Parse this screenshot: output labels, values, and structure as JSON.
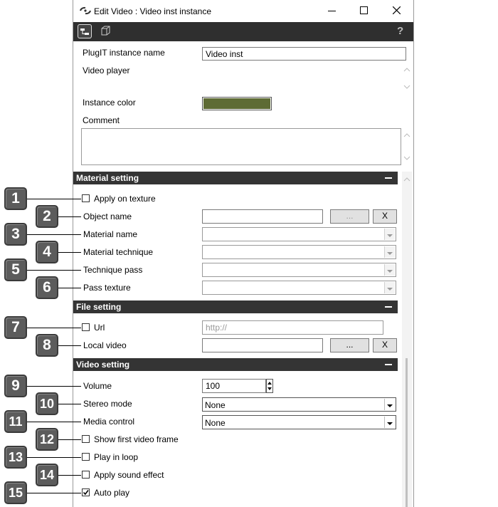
{
  "window": {
    "title": "Edit Video : Video inst instance",
    "minimize_glyph": "—",
    "maximize_glyph": "☐",
    "close_glyph": "✕"
  },
  "toolbar": {
    "help_glyph": "?"
  },
  "header": {
    "instance_name_label": "PlugIT instance name",
    "instance_name_value": "Video inst",
    "player_label": "Video player",
    "color_label": "Instance color",
    "color_value": "#5e6b35",
    "comment_label": "Comment",
    "comment_value": ""
  },
  "material": {
    "title": "Material setting",
    "apply_on_texture": "Apply on texture",
    "apply_on_texture_checked": false,
    "object_name_label": "Object name",
    "object_name_value": "",
    "browse_label": "...",
    "clear_label": "X",
    "material_name_label": "Material name",
    "material_technique_label": "Material technique",
    "technique_pass_label": "Technique pass",
    "pass_texture_label": "Pass texture"
  },
  "file": {
    "title": "File setting",
    "url_label": "Url",
    "url_checked": false,
    "url_placeholder": "http://",
    "local_video_label": "Local video",
    "local_video_value": "",
    "browse_label": "...",
    "clear_label": "X"
  },
  "video": {
    "title": "Video setting",
    "volume_label": "Volume",
    "volume_value": "100",
    "stereo_label": "Stereo mode",
    "stereo_value": "None",
    "media_control_label": "Media control",
    "media_control_value": "None",
    "show_first_frame": "Show first video frame",
    "show_first_frame_checked": false,
    "play_in_loop": "Play in loop",
    "play_in_loop_checked": false,
    "apply_sound_effect": "Apply sound effect",
    "apply_sound_effect_checked": false,
    "auto_play": "Auto play",
    "auto_play_checked": true
  },
  "callouts": [
    "1",
    "2",
    "3",
    "4",
    "5",
    "6",
    "7",
    "8",
    "9",
    "10",
    "11",
    "12",
    "13",
    "14",
    "15"
  ]
}
